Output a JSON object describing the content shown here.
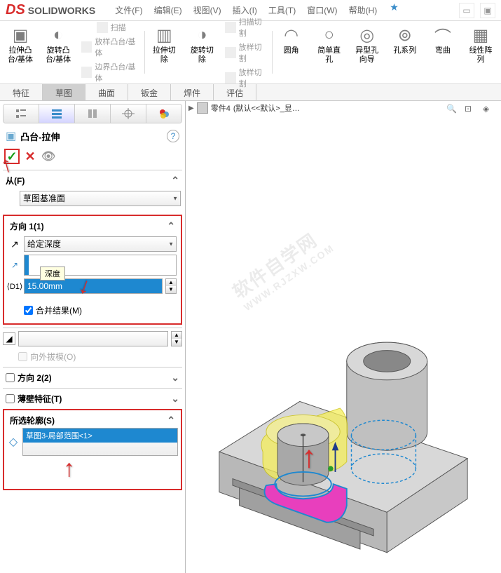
{
  "app": {
    "logo_ds": "DS",
    "logo_text": "SOLIDWORKS"
  },
  "menu": [
    "文件(F)",
    "编辑(E)",
    "视图(V)",
    "插入(I)",
    "工具(T)",
    "窗口(W)",
    "帮助(H)"
  ],
  "ribbon": {
    "extrude_boss": "拉伸凸台/基体",
    "revolve_boss": "旋转凸台/基体",
    "sweep": "扫描",
    "loft": "放样凸台/基体",
    "boundary": "边界凸台/基体",
    "extrude_cut": "拉伸切除",
    "revolve_cut": "旋转切除",
    "sweep_cut": "扫描切割",
    "loft_cut": "放样切割",
    "boundary_cut": "放样切割",
    "fillet": "圆角",
    "simple_hole": "简单直孔",
    "hole_wizard": "异型孔向导",
    "hole_series": "孔系列",
    "wrap": "弯曲",
    "linear_pattern": "线性阵列"
  },
  "tabs": [
    "特征",
    "草图",
    "曲面",
    "钣金",
    "焊件",
    "评估"
  ],
  "feature": {
    "title": "凸台-拉伸",
    "from_label": "从(F)",
    "from_value": "草图基准面",
    "dir1_label": "方向 1(1)",
    "end_condition": "给定深度",
    "depth_tooltip": "深度",
    "depth_value": "15.00mm",
    "merge_result": "合并结果(M)",
    "draft_label": "向外拔模(O)",
    "dir2_label": "方向 2(2)",
    "thin_label": "薄壁特征(T)",
    "contours_label": "所选轮廓(S)",
    "contour_item": "草图3-局部范围<1>"
  },
  "breadcrumb": {
    "part": "零件4",
    "config": "(默认<<默认>_显…"
  },
  "watermark": "软件自学网",
  "watermark2": "WWW.RJZXW.COM"
}
